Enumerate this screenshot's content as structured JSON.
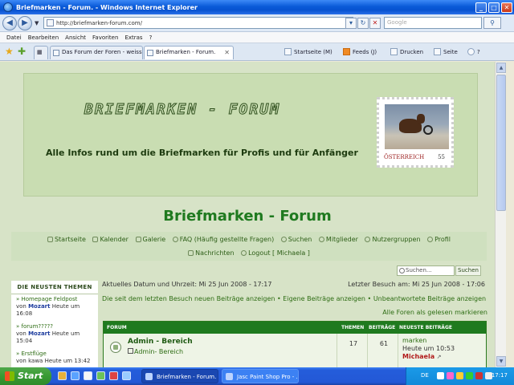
{
  "window": {
    "title": "Briefmarken - Forum. - Windows Internet Explorer"
  },
  "addressbar": {
    "url": "http://briefmarken-forum.com/",
    "search_placeholder": "Google"
  },
  "menu": [
    "Datei",
    "Bearbeiten",
    "Ansicht",
    "Favoriten",
    "Extras",
    "?"
  ],
  "tabs": [
    {
      "label": "Das Forum der Foren - weiss..."
    },
    {
      "label": "Briefmarken - Forum."
    }
  ],
  "toolbar": {
    "home": "Startseite (M)",
    "feeds": "Feeds (J)",
    "print": "Drucken",
    "page": "Seite",
    "tools_q": "?"
  },
  "banner": {
    "logo": "BRIEFMARKEN - FORUM",
    "tagline": "Alle Infos rund um die Briefmarken für Profis und für Anfänger",
    "stamp_country": "ÖSTERREICH",
    "stamp_value": "55"
  },
  "site_title": "Briefmarken - Forum",
  "nav": {
    "line1": [
      "Startseite",
      "Kalender",
      "Galerie",
      "FAQ (Häufig gestellte Fragen)",
      "Suchen",
      "Mitglieder",
      "Nutzergruppen",
      "Profil"
    ],
    "line2": [
      "Nachrichten",
      "Logout [ Michaela ]"
    ]
  },
  "search": {
    "placeholder": "Suchen...",
    "button": "Suchen"
  },
  "sidebar": {
    "heading": "DIE NEUSTEN THEMEN",
    "items": [
      {
        "title": "» Homepage Feldpost",
        "prefix": "von ",
        "user": "Mozart",
        "time": " Heute um 16:08"
      },
      {
        "title": "» forum?????",
        "prefix": "von ",
        "user": "Mozart",
        "time": " Heute um 15:04"
      },
      {
        "title": "» Erstflüge",
        "prefix": "von ",
        "user": "kawa",
        "time": " Heute um 13:42"
      }
    ]
  },
  "info": {
    "current_date": "Aktuelles Datum und Uhrzeit: Mi 25 Jun 2008 - 17:17",
    "last_visit": "Letzter Besuch am: Mi 25 Jun 2008 - 17:06",
    "link_new": "Die seit dem letzten Besuch neuen Beiträge anzeigen",
    "sep": " • ",
    "link_own": "Eigene Beiträge anzeigen",
    "link_unanswered": "Unbeantwortete Beiträge anzeigen",
    "mark_all": "Alle Foren als gelesen markieren"
  },
  "forum_table": {
    "headers": {
      "forum": "FORUM",
      "themen": "THEMEN",
      "beitraege": "BEITRÄGE",
      "neueste": "NEUESTE BEITRÄGE"
    },
    "rows": [
      {
        "name": "Admin - Bereich",
        "sub": "Admin- Bereich",
        "themen": "17",
        "beitraege": "61",
        "last_title": "marken",
        "last_time": "Heute um 10:53",
        "last_user": "Michaela"
      }
    ]
  },
  "taskbar": {
    "start": "Start",
    "buttons": [
      "Briefmarken - Forum. ...",
      "Jasc Paint Shop Pro - ..."
    ],
    "lang": "DE",
    "clock": "17:17"
  }
}
